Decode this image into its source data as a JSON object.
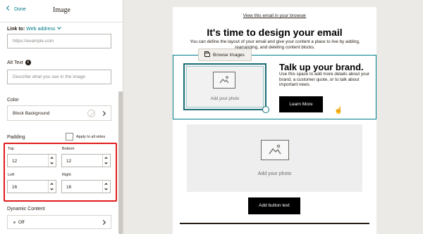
{
  "panel": {
    "back_label": "Done",
    "title": "Image",
    "link_to_label": "Link to:",
    "link_to_value": "Web address",
    "url_placeholder": "https://example.com",
    "alt_text_label": "Alt Text",
    "alt_text_placeholder": "Describe what you see in the image",
    "color_label": "Color",
    "color_value": "Block Background",
    "padding_label": "Padding",
    "apply_all_label": "Apply to all sides",
    "padding": {
      "top_label": "Top",
      "top_value": "12",
      "bottom_label": "Bottom",
      "bottom_value": "12",
      "left_label": "Left",
      "left_value": "16",
      "right_label": "Right",
      "right_value": "16"
    },
    "dynamic_label": "Dynamic Content",
    "dynamic_value": "Off"
  },
  "canvas": {
    "view_link": "View this email in your browser",
    "headline": "It's time to design your email",
    "subtext": "You can define the layout of your email and give your content a place to live by adding, rearranging, and deleting content blocks.",
    "browse_label": "Browse Images",
    "photo_label_1": "Add your photo",
    "talk_title": "Talk up your brand.",
    "talk_body": "Use this space to add more details about your brand, a customer quote, or to talk about important news.",
    "learn_more": "Learn More",
    "photo_label_2": "Add your photo",
    "add_button": "Add button text"
  },
  "colors": {
    "accent": "#007c89",
    "highlight": "#e01c1c",
    "button_bg": "#000000"
  },
  "icons": [
    "chevron-left-icon",
    "chevron-down-icon",
    "info-icon",
    "chevron-right-icon",
    "folder-icon",
    "image-placeholder-icon",
    "cursor-icon"
  ]
}
